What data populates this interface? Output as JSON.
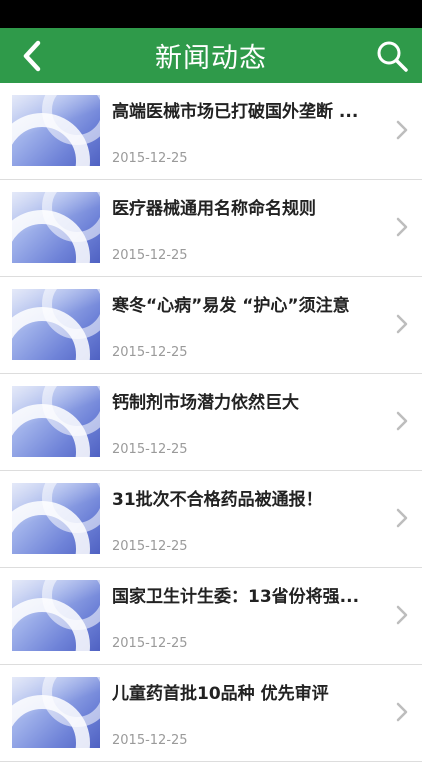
{
  "header": {
    "title": "新闻动态"
  },
  "news": [
    {
      "title": "高端医械市场已打破国外垄断 ...",
      "date": "2015-12-25"
    },
    {
      "title": "医疗器械通用名称命名规则",
      "date": "2015-12-25"
    },
    {
      "title": "寒冬“心病”易发 “护心”须注意",
      "date": "2015-12-25"
    },
    {
      "title": "钙制剂市场潜力依然巨大",
      "date": "2015-12-25"
    },
    {
      "title": "31批次不合格药品被通报！",
      "date": "2015-12-25"
    },
    {
      "title": "国家卫生计生委：13省份将强...",
      "date": "2015-12-25"
    },
    {
      "title": "儿童药首批10品种 优先审评",
      "date": "2015-12-25"
    }
  ],
  "colors": {
    "header_bg": "#2f9a4a",
    "divider": "#dddddd",
    "date": "#9a9a9a"
  },
  "icons": {
    "back": "chevron-left-icon",
    "search": "search-icon",
    "row": "chevron-right-icon"
  }
}
